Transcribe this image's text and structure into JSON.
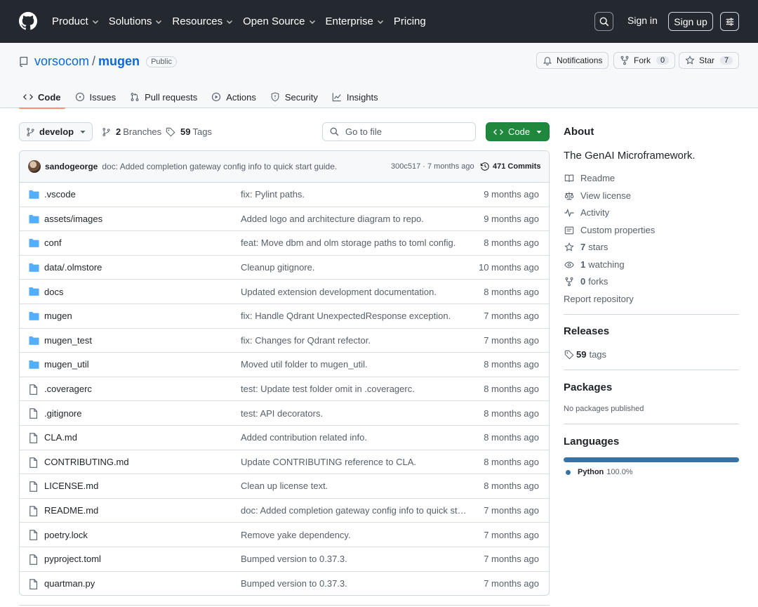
{
  "topnav": {
    "items": [
      "Product",
      "Solutions",
      "Resources",
      "Open Source",
      "Enterprise",
      "Pricing"
    ],
    "sign_in": "Sign in",
    "sign_up": "Sign up"
  },
  "repo": {
    "owner": "vorsocom",
    "separator": "/",
    "name": "mugen",
    "visibility": "Public",
    "notifications_label": "Notifications",
    "fork_label": "Fork",
    "fork_count": "0",
    "star_label": "Star",
    "star_count": "7"
  },
  "tabs": [
    "Code",
    "Issues",
    "Pull requests",
    "Actions",
    "Security",
    "Insights"
  ],
  "controls": {
    "branch": "develop",
    "branches_count": "2",
    "branches_label": "Branches",
    "tags_count": "59",
    "tags_label": "Tags",
    "goto_placeholder": "Go to file",
    "code_label": "Code"
  },
  "latest_commit": {
    "author": "sandogeorge",
    "message": "doc: Added completion gateway config info to quick start guide.",
    "sha_time": "300c517 · 7 months ago",
    "commits": "471 Commits"
  },
  "files": [
    {
      "type": "dir",
      "name": ".vscode",
      "message": "fix: Pylint paths.",
      "date": "9 months ago"
    },
    {
      "type": "dir",
      "name": "assets/images",
      "message": "Added logo and architecture diagram to repo.",
      "date": "9 months ago"
    },
    {
      "type": "dir",
      "name": "conf",
      "message": "feat: Move dbm and olm storage paths to toml config.",
      "date": "8 months ago"
    },
    {
      "type": "dir",
      "name": "data/.olmstore",
      "message": "Cleanup gitignore.",
      "date": "10 months ago"
    },
    {
      "type": "dir",
      "name": "docs",
      "message": "Updated extension development documentation.",
      "date": "8 months ago"
    },
    {
      "type": "dir",
      "name": "mugen",
      "message": "fix: Handle Qdrant UnexpectedResponse exception.",
      "date": "7 months ago"
    },
    {
      "type": "dir",
      "name": "mugen_test",
      "message": "fix: Changes for Qdrant refector.",
      "date": "7 months ago"
    },
    {
      "type": "dir",
      "name": "mugen_util",
      "message": "Moved util folder to mugen_util.",
      "date": "8 months ago"
    },
    {
      "type": "file",
      "name": ".coveragerc",
      "message": "test: Update test folder omit in .coveragerc.",
      "date": "8 months ago"
    },
    {
      "type": "file",
      "name": ".gitignore",
      "message": "test: API decorators.",
      "date": "8 months ago"
    },
    {
      "type": "file",
      "name": "CLA.md",
      "message": "Added contribution related info.",
      "date": "8 months ago"
    },
    {
      "type": "file",
      "name": "CONTRIBUTING.md",
      "message": "Update CONTRIBUTING reference to CLA.",
      "date": "8 months ago"
    },
    {
      "type": "file",
      "name": "LICENSE.md",
      "message": "Clean up license text.",
      "date": "8 months ago"
    },
    {
      "type": "file",
      "name": "README.md",
      "message": "doc: Added completion gateway config info to quick star…",
      "date": "7 months ago"
    },
    {
      "type": "file",
      "name": "poetry.lock",
      "message": "Remove yake dependency.",
      "date": "7 months ago"
    },
    {
      "type": "file",
      "name": "pyproject.toml",
      "message": "Bumped version to 0.37.3.",
      "date": "7 months ago"
    },
    {
      "type": "file",
      "name": "quartman.py",
      "message": "Bumped version to 0.37.3.",
      "date": "7 months ago"
    }
  ],
  "about": {
    "heading": "About",
    "description": "The GenAI Microframework.",
    "readme": "Readme",
    "license": "View license",
    "activity": "Activity",
    "custom_properties": "Custom properties",
    "stars_count": "7",
    "stars_label": "stars",
    "watching_count": "1",
    "watching_label": "watching",
    "forks_count": "0",
    "forks_label": "forks",
    "report": "Report repository"
  },
  "releases": {
    "heading": "Releases",
    "tags_count": "59",
    "tags_label": "tags"
  },
  "packages": {
    "heading": "Packages",
    "empty": "No packages published"
  },
  "languages": {
    "heading": "Languages",
    "items": [
      {
        "name": "Python",
        "percent": "100.0%",
        "color": "#3572a5"
      }
    ]
  },
  "colors": {
    "header_bg": "#24292f",
    "accent_link": "#0969da",
    "code_button": "#1f883d",
    "folder_icon": "#54aeff",
    "active_tab_underline": "#fd8c73"
  }
}
